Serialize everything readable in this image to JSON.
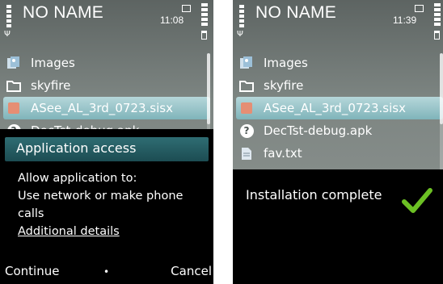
{
  "left_screen": {
    "title": "NO NAME",
    "clock": "11:08",
    "files": [
      {
        "name": "Images",
        "icon": "images-icon"
      },
      {
        "name": "skyfire",
        "icon": "folder-icon"
      },
      {
        "name": "ASee_AL_3rd_0723.sisx",
        "icon": "sisx-file-icon",
        "selected": true
      },
      {
        "name": "DecTst-debug.apk",
        "icon": "help-icon"
      }
    ],
    "dialog": {
      "title": "Application access",
      "line1": "Allow application to:",
      "line2": "Use network or make phone",
      "line3": "calls",
      "link": "Additional details"
    },
    "softkeys": {
      "left": "Continue",
      "center": "•",
      "right": "Cancel"
    }
  },
  "right_screen": {
    "title": "NO NAME",
    "clock": "11:39",
    "files": [
      {
        "name": "Images",
        "icon": "images-icon"
      },
      {
        "name": "skyfire",
        "icon": "folder-icon"
      },
      {
        "name": "ASee_AL_3rd_0723.sisx",
        "icon": "sisx-file-icon",
        "selected": true
      },
      {
        "name": "DecTst-debug.apk",
        "icon": "help-icon"
      },
      {
        "name": "fav.txt",
        "icon": "text-file-icon"
      }
    ],
    "notice": {
      "text": "Installation complete",
      "icon": "checkmark-icon"
    }
  },
  "colors": {
    "highlight": "#9fc8cc",
    "dialog_header": "#2f6d73",
    "checkmark": "#6cc024",
    "sisx_icon": "#e58e74"
  }
}
